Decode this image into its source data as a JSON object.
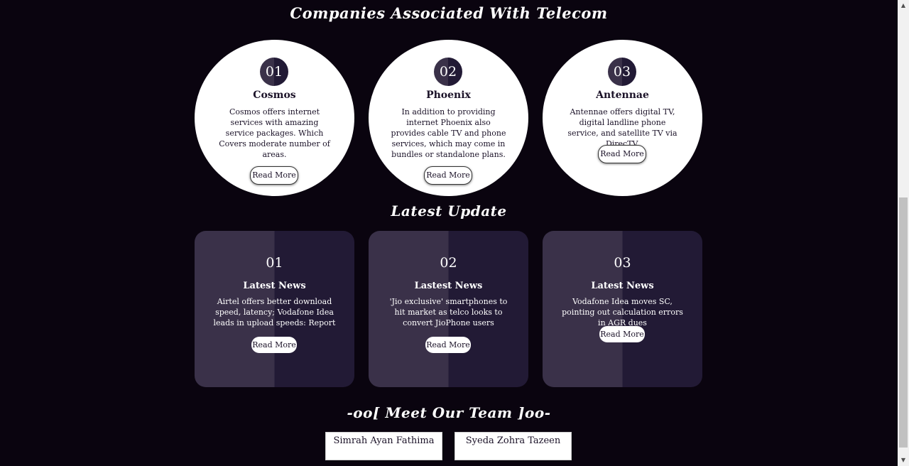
{
  "companies_section": {
    "title": "Companies Associated With Telecom",
    "items": [
      {
        "num": "01",
        "name": "Cosmos",
        "desc": "Cosmos offers internet services with amazing service packages. Which Covers moderate number of areas.",
        "button": "Read More"
      },
      {
        "num": "02",
        "name": "Phoenix",
        "desc": "In addition to providing internet Phoenix also provides cable TV and phone services, which may come in bundles or standalone plans.",
        "button": "Read More"
      },
      {
        "num": "03",
        "name": "Antennae",
        "desc": "Antennae offers digital TV, digital landline phone service, and satellite TV via DirecTV.",
        "button": "Read More"
      }
    ]
  },
  "updates_section": {
    "title": "Latest Update",
    "items": [
      {
        "num": "01",
        "title": "Latest News",
        "desc": "Airtel offers better download speed, latency; Vodafone Idea leads in upload speeds: Report",
        "button": "Read More"
      },
      {
        "num": "02",
        "title": "Lastest News",
        "desc": "'Jio exclusive' smartphones to hit market as telco looks to convert JioPhone users",
        "button": "Read More"
      },
      {
        "num": "03",
        "title": "Latest News",
        "desc": "Vodafone Idea moves SC, pointing out calculation errors in AGR dues",
        "button": "Read More"
      }
    ]
  },
  "team_section": {
    "title": "-oo[ Meet Our Team ]oo-",
    "members": [
      {
        "name": "Simrah Ayan Fathima"
      },
      {
        "name": "Syeda Zohra Tazeen"
      }
    ]
  }
}
